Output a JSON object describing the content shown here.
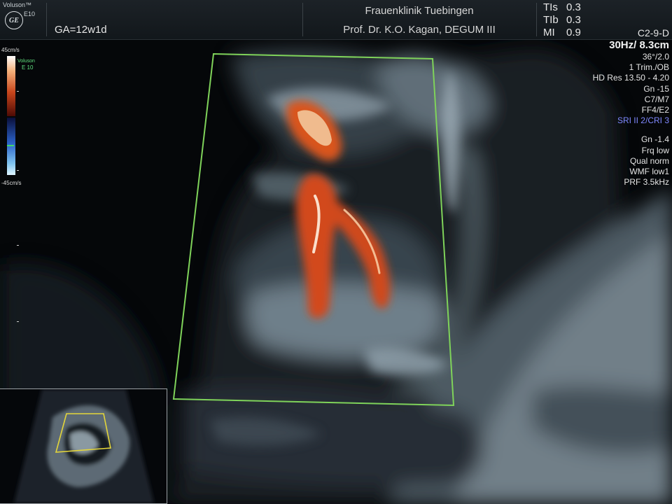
{
  "header": {
    "brand": "Voluson™",
    "brand_model": "E10",
    "logo_text": "GE",
    "gestational_age": "GA=12w1d",
    "clinic": "Frauenklinik Tuebingen",
    "doctor": "Prof. Dr. K.O. Kagan, DEGUM III",
    "indices": [
      {
        "label": "TIs",
        "value": "0.3"
      },
      {
        "label": "TIb",
        "value": "0.3"
      },
      {
        "label": "MI",
        "value": "0.9"
      }
    ]
  },
  "color_scale": {
    "top_label": "45cm/s",
    "bottom_label": "-45cm/s",
    "brand_small": "Voluson",
    "model_small": "E 10"
  },
  "parameters": {
    "probe": "C2-9-D",
    "frame_depth": "30Hz/ 8.3cm",
    "angle": "36°/2.0",
    "preset": "1 Trim./OB",
    "hd_res": "HD Res 13.50 - 4.20",
    "gain": "Gn -15",
    "cm": "C7/M7",
    "ff": "FF4/E2",
    "sri": "SRI II 2/CRI 3",
    "color_gain": "Gn -1.4",
    "frequency": "Frq low",
    "quality": "Qual norm",
    "wmf": "WMF low1",
    "prf": "PRF  3.5kHz"
  },
  "colors": {
    "roi_box": "#7fd35a",
    "thumb_roi": "#e4d63a",
    "sri_text": "#7f88ff",
    "doppler_flow": "#e0612a"
  },
  "icons": [
    "ge-logo-icon"
  ]
}
